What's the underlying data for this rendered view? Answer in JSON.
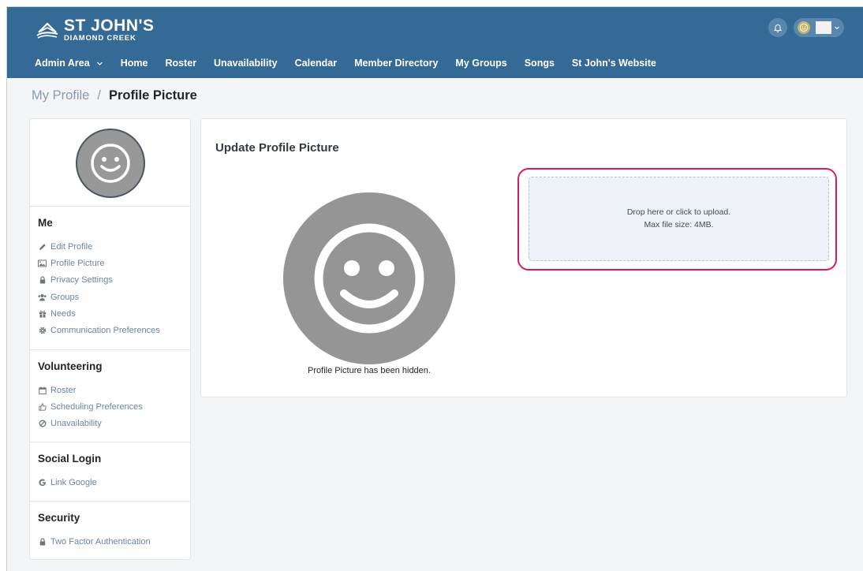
{
  "brand": {
    "line1": "ST JOHN'S",
    "line2": "DIAMOND CREEK"
  },
  "nav": {
    "items": [
      {
        "label": "Admin Area",
        "has_dropdown": true
      },
      {
        "label": "Home"
      },
      {
        "label": "Roster"
      },
      {
        "label": "Unavailability"
      },
      {
        "label": "Calendar"
      },
      {
        "label": "Member Directory"
      },
      {
        "label": "My Groups"
      },
      {
        "label": "Songs"
      },
      {
        "label": "St John's Website"
      }
    ]
  },
  "header": {
    "icons": [
      "bell-icon",
      "smiley-icon",
      "chevron-down-icon"
    ]
  },
  "breadcrumb": {
    "parent": "My Profile",
    "separator": "/",
    "current": "Profile Picture"
  },
  "sidebar": {
    "sections": [
      {
        "heading": "Me",
        "items": [
          {
            "label": "Edit Profile",
            "icon": "pencil-icon"
          },
          {
            "label": "Profile Picture",
            "icon": "image-icon"
          },
          {
            "label": "Privacy Settings",
            "icon": "lock-icon"
          },
          {
            "label": "Groups",
            "icon": "users-icon"
          },
          {
            "label": "Needs",
            "icon": "gift-icon"
          },
          {
            "label": "Communication Preferences",
            "icon": "gear-icon"
          }
        ]
      },
      {
        "heading": "Volunteering",
        "items": [
          {
            "label": "Roster",
            "icon": "calendar-icon"
          },
          {
            "label": "Scheduling Preferences",
            "icon": "thumbs-up-icon"
          },
          {
            "label": "Unavailability",
            "icon": "ban-icon"
          }
        ]
      },
      {
        "heading": "Social Login",
        "items": [
          {
            "label": "Link Google",
            "icon": "google-icon"
          }
        ]
      },
      {
        "heading": "Security",
        "items": [
          {
            "label": "Two Factor Authentication",
            "icon": "lock-icon"
          }
        ]
      }
    ]
  },
  "main": {
    "title": "Update Profile Picture",
    "hidden_message": "Profile Picture has been hidden.",
    "dropzone": {
      "line1": "Drop here or click to upload.",
      "line2": "Max file size: 4MB."
    }
  },
  "colors": {
    "header_bg": "#356a96",
    "highlight": "#d81b60",
    "link": "#6c85a3",
    "avatar_gray": "#959595"
  }
}
